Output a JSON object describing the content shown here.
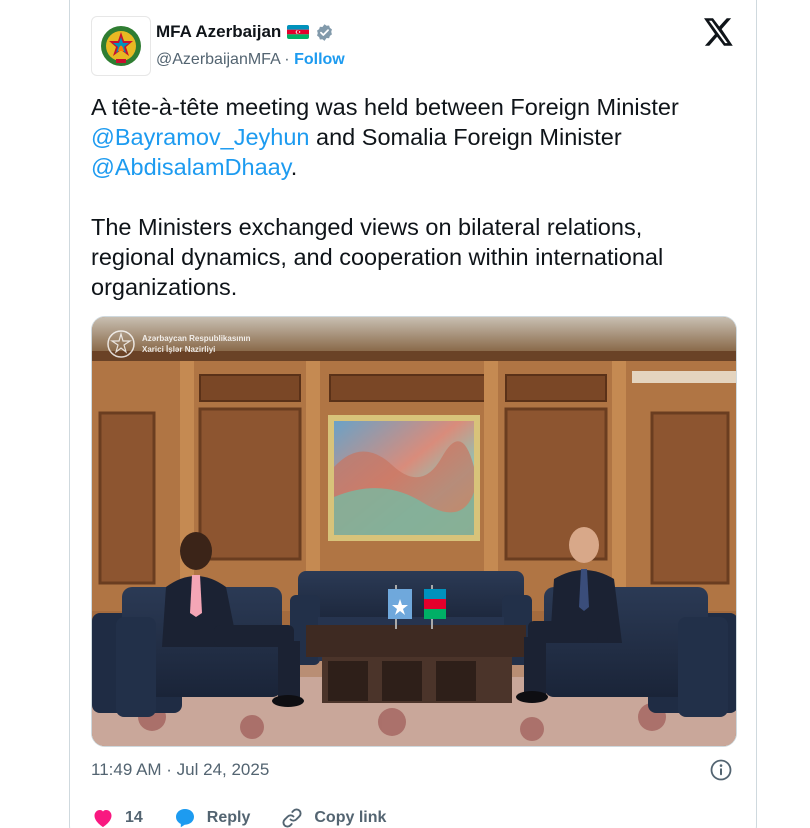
{
  "account": {
    "display_name": "MFA Azerbaijan",
    "handle": "@AzerbaijanMFA",
    "separator": " · ",
    "follow_label": "Follow"
  },
  "tweet": {
    "line1_pre": "A tête-à-tête meeting was held between Foreign Minister ",
    "mention1": "@Bayramov_Jeyhun",
    "line1_mid": " and Somalia Foreign Minister ",
    "mention2": "@AbdisalamDhaay",
    "line1_post": ".",
    "para2": "The Ministers exchanged views on bilateral relations, regional dynamics, and cooperation within international organizations."
  },
  "photo": {
    "watermark_line1": "Azərbaycan Respublikasının",
    "watermark_line2": "Xarici İşlər Nazirliyi"
  },
  "meta": {
    "timestamp": "11:49 AM · Jul 24, 2025"
  },
  "actions": {
    "like_count": "14",
    "reply_label": "Reply",
    "copy_label": "Copy link"
  },
  "colors": {
    "accent": "#1d9bf0",
    "like": "#f91880",
    "muted": "#536471"
  },
  "icons": [
    "emblem-icon",
    "azerbaijan-flag-icon",
    "verified-badge-icon",
    "x-logo-icon",
    "info-icon",
    "heart-icon",
    "reply-icon",
    "link-icon"
  ]
}
